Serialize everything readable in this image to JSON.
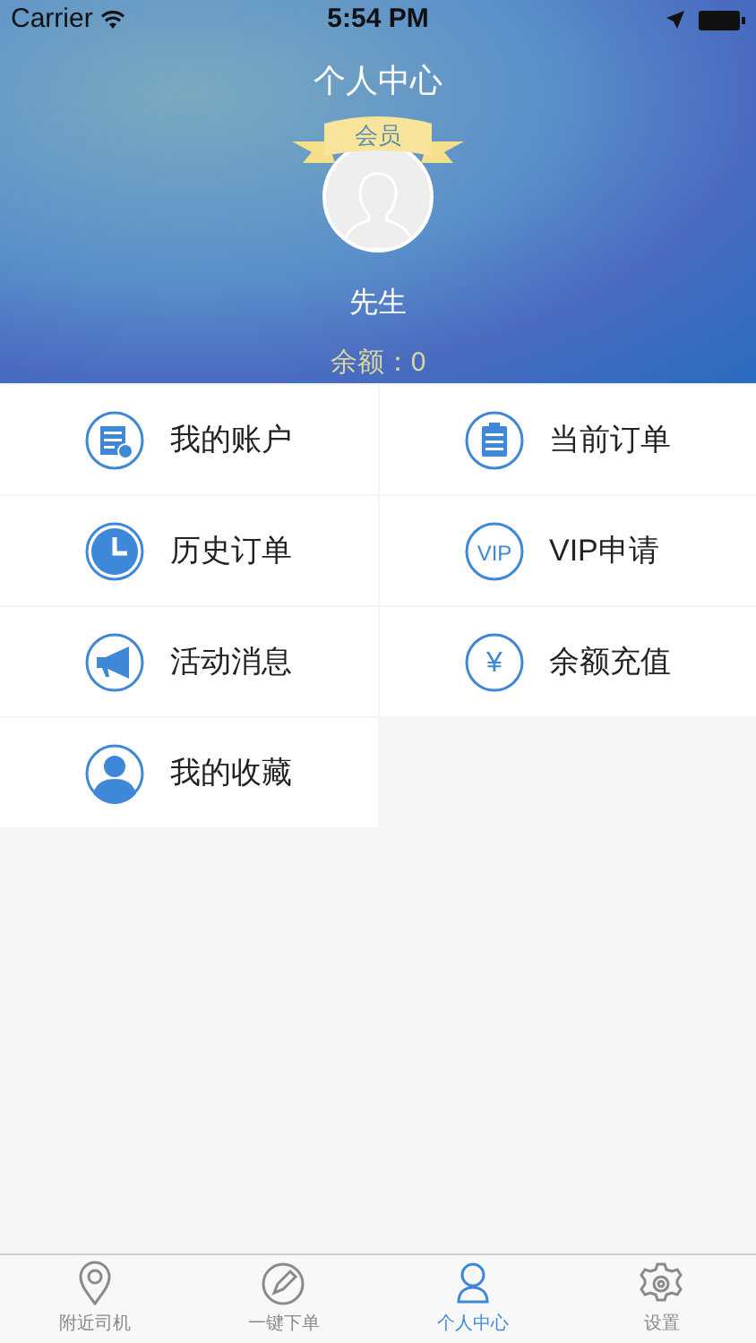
{
  "status_bar": {
    "carrier": "Carrier",
    "time": "5:54 PM"
  },
  "header": {
    "title": "个人中心",
    "badge": "会员",
    "name": "先生",
    "balance": "余额：0"
  },
  "menu": [
    {
      "kind": "account",
      "label": "我的账户"
    },
    {
      "kind": "clipboard",
      "label": "当前订单"
    },
    {
      "kind": "clock",
      "label": "历史订单"
    },
    {
      "kind": "text",
      "icon_label": "VIP",
      "label": "VIP申请"
    },
    {
      "kind": "megaphone",
      "label": "活动消息"
    },
    {
      "kind": "text",
      "icon_label": "¥",
      "label": "余额充值"
    },
    {
      "kind": "person",
      "label": "我的收藏"
    }
  ],
  "tabs": [
    {
      "kind": "pin",
      "label": "附近司机",
      "selected": false
    },
    {
      "kind": "pencil",
      "label": "一键下单",
      "selected": false
    },
    {
      "kind": "user",
      "label": "个人中心",
      "selected": true
    },
    {
      "kind": "gear",
      "label": "设置",
      "selected": false
    }
  ]
}
